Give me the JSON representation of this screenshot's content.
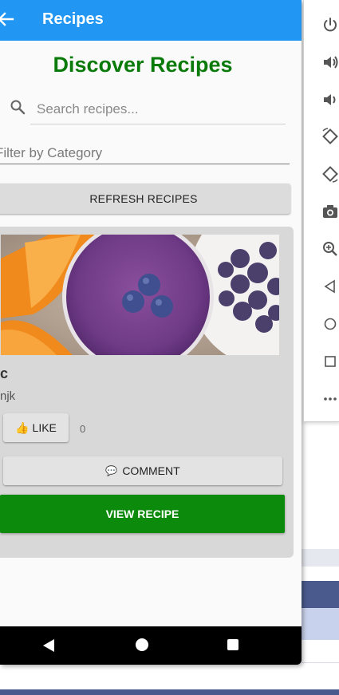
{
  "app_bar": {
    "title": "Recipes"
  },
  "heading": "Discover Recipes",
  "search": {
    "placeholder": "Search recipes..."
  },
  "filter": {
    "placeholder": "Filter by Category"
  },
  "refresh_button": "REFRESH RECIPES",
  "card": {
    "title": "c",
    "description": "njk",
    "like_label": "LIKE",
    "like_icon": "👍",
    "like_count": "0",
    "comment_label": "COMMENT",
    "comment_icon": "💬",
    "view_label": "VIEW RECIPE"
  },
  "toolbar_icons": [
    "power-icon",
    "volume-up-icon",
    "volume-down-icon",
    "rotate-left-icon",
    "rotate-right-icon",
    "camera-icon",
    "zoom-icon",
    "back-icon",
    "home-icon",
    "overview-icon",
    "more-icon"
  ],
  "colors": {
    "app_bar": "#2196f3",
    "heading": "#0a7a0a",
    "view_button": "#0b8a0b",
    "card": "#d8d8d8"
  }
}
